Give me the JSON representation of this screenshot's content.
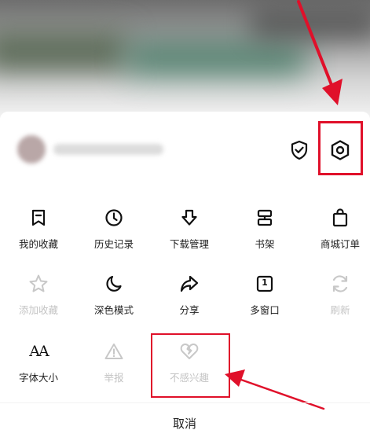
{
  "menu": {
    "row1": [
      {
        "label": "我的收藏",
        "icon": "bookmark-icon"
      },
      {
        "label": "历史记录",
        "icon": "clock-icon"
      },
      {
        "label": "下载管理",
        "icon": "download-arrow-icon"
      },
      {
        "label": "书架",
        "icon": "bookshelf-icon"
      },
      {
        "label": "商城订单",
        "icon": "shopping-bag-icon"
      }
    ],
    "row2": [
      {
        "label": "添加收藏",
        "icon": "star-icon",
        "disabled": true
      },
      {
        "label": "深色模式",
        "icon": "moon-icon"
      },
      {
        "label": "分享",
        "icon": "share-arrow-icon"
      },
      {
        "label": "多窗口",
        "icon": "multi-window-icon",
        "badge": "1"
      },
      {
        "label": "刷新",
        "icon": "refresh-icon",
        "disabled": true
      }
    ],
    "row3": [
      {
        "label": "字体大小",
        "icon": "font-size-icon",
        "glyph": "AA"
      },
      {
        "label": "举报",
        "icon": "warning-icon",
        "disabled": true
      },
      {
        "label": "不感兴趣",
        "icon": "broken-heart-icon",
        "disabled": true
      }
    ]
  },
  "cancel_label": "取消",
  "colors": {
    "annotation_red": "#e0102a",
    "text": "#222222",
    "disabled": "#c4c4c4"
  }
}
